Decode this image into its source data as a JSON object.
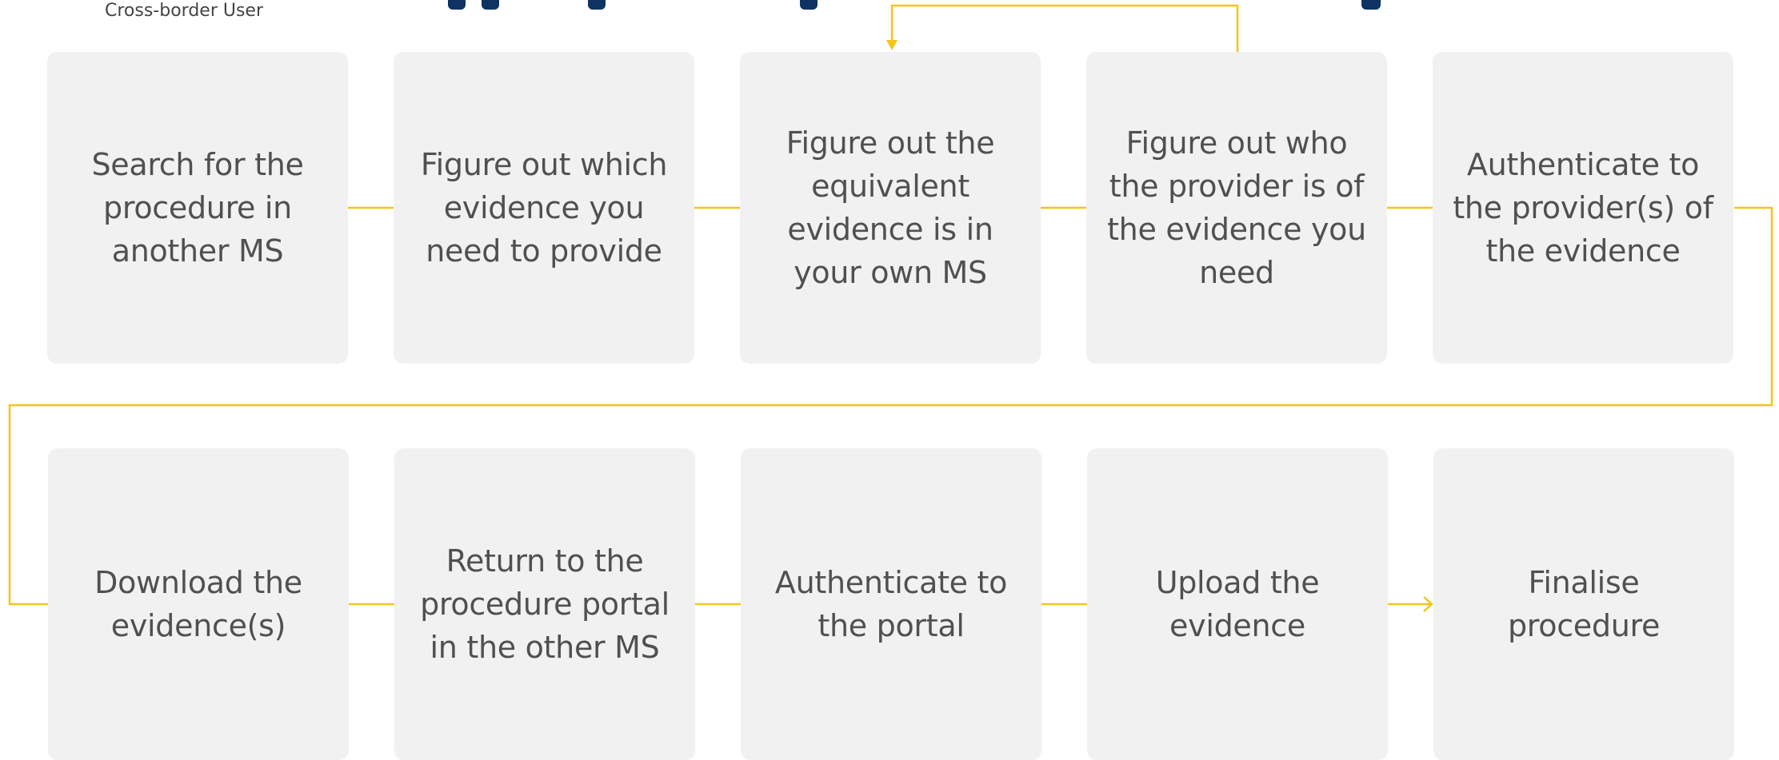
{
  "header": {
    "subtitle": "Cross-border User"
  },
  "colors": {
    "connector": "#f5c518",
    "box_fill": "#f1f1f1",
    "box_text": "#505050",
    "title": "#0e3363"
  },
  "steps": [
    {
      "label": "Search for the procedure in another MS"
    },
    {
      "label": "Figure out which evidence you need to provide"
    },
    {
      "label": "Figure out the equivalent evidence is in your own MS"
    },
    {
      "label": "Figure out who the provider is of the evidence you need"
    },
    {
      "label": "Authenticate to the provider(s) of the evidence"
    },
    {
      "label": "Download the evidence(s)"
    },
    {
      "label": "Return to the procedure portal in the other MS"
    },
    {
      "label": "Authenticate to the portal"
    },
    {
      "label": "Upload the evidence"
    },
    {
      "label": "Finalise procedure"
    }
  ]
}
